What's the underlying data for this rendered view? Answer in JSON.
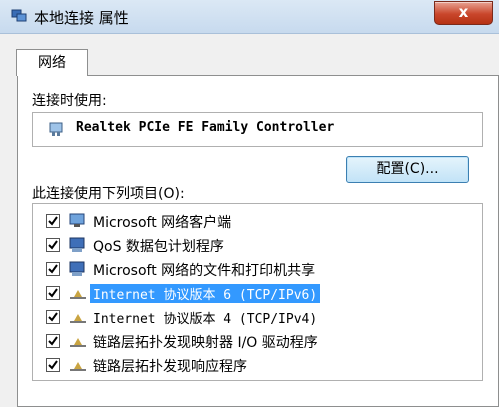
{
  "window": {
    "title": "本地连接 属性",
    "close_label": "x"
  },
  "tabs": [
    {
      "label": "网络"
    }
  ],
  "connect_using": {
    "label": "连接时使用:",
    "adapter": "Realtek PCIe FE Family Controller",
    "config_button": "配置(C)..."
  },
  "items_section": {
    "label": "此连接使用下列项目(O):",
    "items": [
      {
        "label": "Microsoft 网络客户端",
        "checked": true,
        "icon": "network-client-icon"
      },
      {
        "label": "QoS 数据包计划程序",
        "checked": true,
        "icon": "qos-scheduler-icon"
      },
      {
        "label": "Microsoft 网络的文件和打印机共享",
        "checked": true,
        "icon": "file-print-sharing-icon"
      },
      {
        "label": "Internet 协议版本 6 (TCP/IPv6)",
        "checked": true,
        "icon": "protocol-icon",
        "selected": true
      },
      {
        "label": "Internet 协议版本 4 (TCP/IPv4)",
        "checked": true,
        "icon": "protocol-icon"
      },
      {
        "label": "链路层拓扑发现映射器 I/O 驱动程序",
        "checked": true,
        "icon": "protocol-icon"
      },
      {
        "label": "链路层拓扑发现响应程序",
        "checked": true,
        "icon": "protocol-icon"
      }
    ]
  },
  "colors": {
    "selection": "#3399ff",
    "close_button": "#c9462b"
  }
}
